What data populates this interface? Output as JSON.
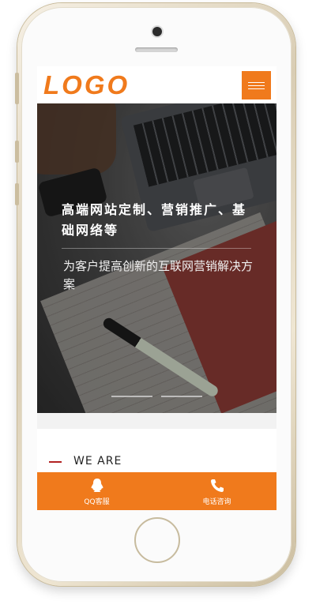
{
  "header": {
    "logo_text": "LOGO",
    "menu_icon": "hamburger-menu-icon"
  },
  "hero": {
    "title": "高端网站定制、营销推广、基础网络等",
    "subtitle": "为客户提高创新的互联网营销解决方案",
    "slides": 2,
    "active_slide": 1
  },
  "section": {
    "title": "WE ARE"
  },
  "footer": {
    "items": [
      {
        "label": "QQ客服",
        "icon": "qq-icon"
      },
      {
        "label": "电话咨询",
        "icon": "phone-icon"
      }
    ]
  },
  "colors": {
    "accent": "#f07a1c",
    "section_line": "#b22222"
  }
}
